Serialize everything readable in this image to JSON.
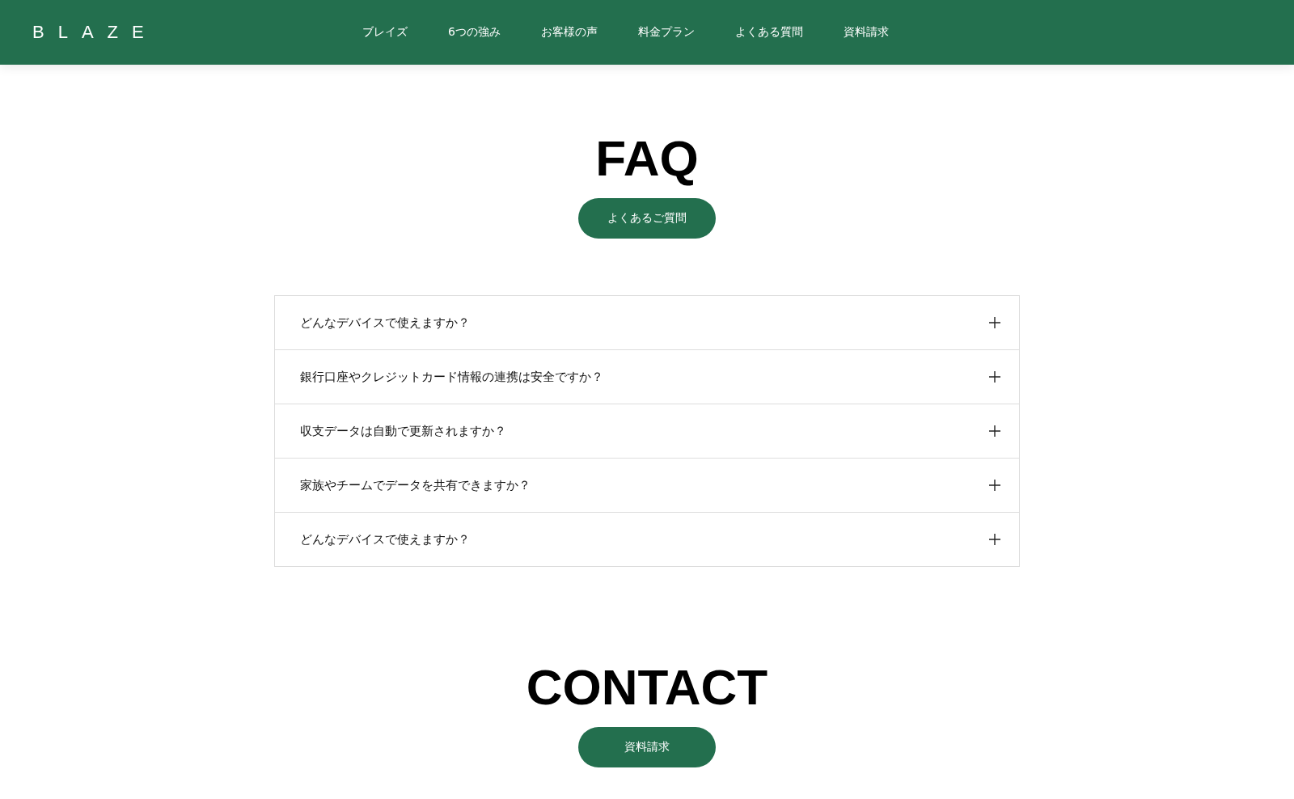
{
  "header": {
    "logo": "BLAZE",
    "nav": [
      {
        "label": "ブレイズ"
      },
      {
        "label": "6つの強み"
      },
      {
        "label": "お客様の声"
      },
      {
        "label": "料金プラン"
      },
      {
        "label": "よくある質問"
      },
      {
        "label": "資料請求"
      }
    ]
  },
  "faq": {
    "title": "FAQ",
    "button": "よくあるご質問",
    "items": [
      {
        "question": "どんなデバイスで使えますか？",
        "expanded": false
      },
      {
        "question": "銀行口座やクレジットカード情報の連携は安全ですか？",
        "expanded": false
      },
      {
        "question": "収支データは自動で更新されますか？",
        "expanded": false
      },
      {
        "question": "家族やチームでデータを共有できますか？",
        "expanded": false
      },
      {
        "question": "どんなデバイスで使えますか？",
        "expanded": false
      }
    ]
  },
  "contact": {
    "title": "CONTACT",
    "button": "資料請求"
  }
}
